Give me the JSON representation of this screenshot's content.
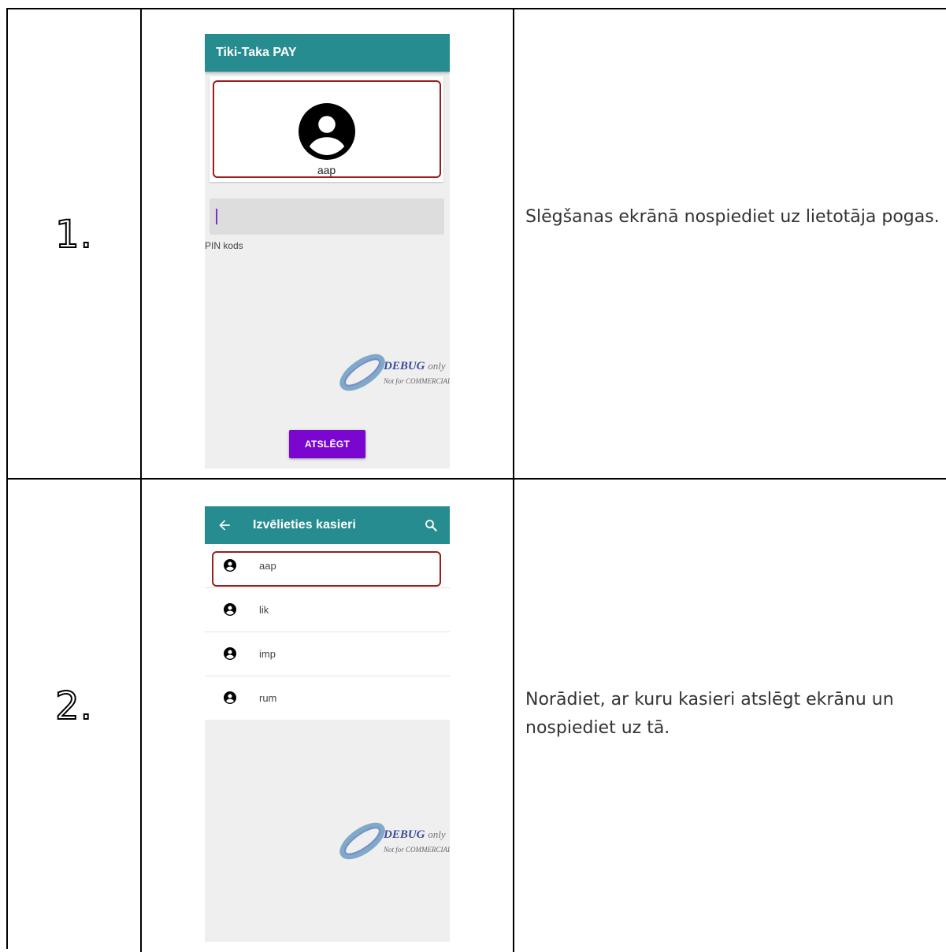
{
  "steps": [
    {
      "number": "1.",
      "description": "Slēgšanas ekrānā nospiediet uz lietotāja pogas.",
      "screen": {
        "app_title": "Tiki-Taka PAY",
        "user_name": "aap",
        "pin_label": "PIN kods",
        "pin_value": "",
        "unlock_button": "ATSLĒGT",
        "watermark": {
          "word": "DEBUG",
          "suffix": "only",
          "sub": "Not for COMMERCIAL"
        }
      }
    },
    {
      "number": "2.",
      "description": "Norādiet, ar kuru kasieri atslēgt ekrānu un nospiediet uz tā.",
      "screen": {
        "app_title": "Izvēlieties kasieri",
        "cashiers": [
          "aap",
          "lik",
          "imp",
          "rum"
        ],
        "watermark": {
          "word": "DEBUG",
          "suffix": "only",
          "sub": "Not for COMMERCIAL"
        }
      }
    }
  ],
  "colors": {
    "appbar": "#268c8f",
    "accent_button": "#7a06cf",
    "highlight": "#9b1c1c",
    "screen_background": "#efefef"
  },
  "icons": {
    "user": "account-circle-icon",
    "back": "arrow-back-icon",
    "search": "search-icon"
  }
}
